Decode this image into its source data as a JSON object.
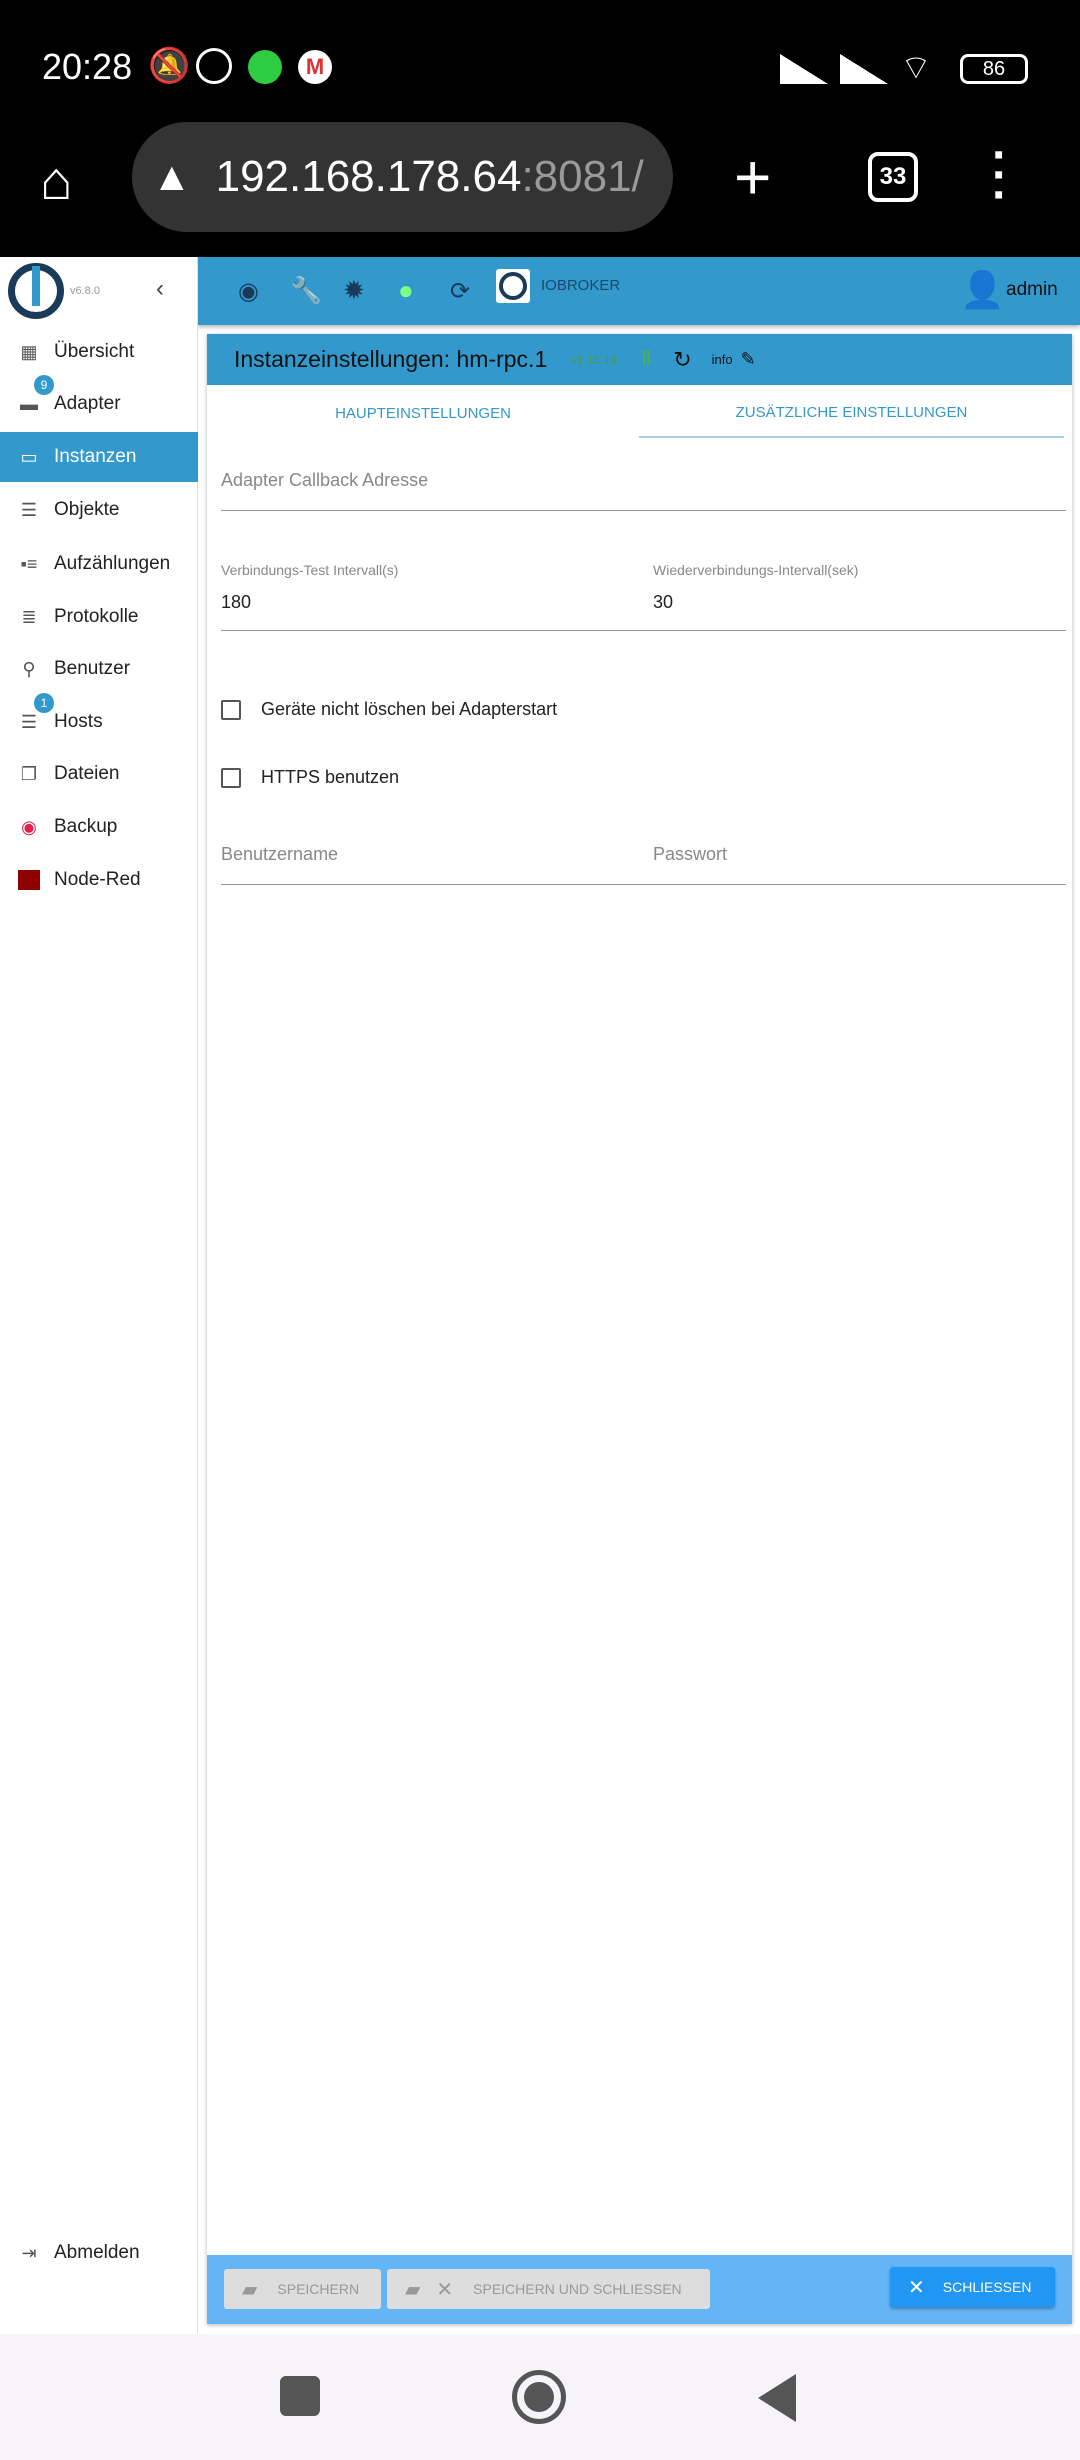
{
  "status_bar": {
    "time": "20:28",
    "battery": "86",
    "icons": [
      "bell-off-icon",
      "alarm-icon",
      "whatsapp-icon",
      "gmail-icon",
      "signal-icon",
      "signal-icon",
      "wifi-icon",
      "battery-icon"
    ]
  },
  "browser": {
    "url_host": "192.168.178.64",
    "url_port": ":8081/",
    "tab_count": "33"
  },
  "sidebar": {
    "version": "v6.8.0",
    "items": [
      {
        "label": "Übersicht",
        "icon": "grid-icon"
      },
      {
        "label": "Adapter",
        "icon": "store-icon",
        "badge": "9"
      },
      {
        "label": "Instanzen",
        "icon": "instances-icon",
        "selected": true
      },
      {
        "label": "Objekte",
        "icon": "list-icon"
      },
      {
        "label": "Aufzählungen",
        "icon": "enum-icon"
      },
      {
        "label": "Protokolle",
        "icon": "log-icon"
      },
      {
        "label": "Benutzer",
        "icon": "user-icon"
      },
      {
        "label": "Hosts",
        "icon": "hosts-icon",
        "badge": "1"
      },
      {
        "label": "Dateien",
        "icon": "files-icon"
      },
      {
        "label": "Backup",
        "icon": "backup-icon"
      },
      {
        "label": "Node-Red",
        "icon": "node-red-icon"
      }
    ],
    "logout": "Abmelden"
  },
  "topbar": {
    "brand": "IOBROKER",
    "user": "admin"
  },
  "instance": {
    "title": "Instanzeinstellungen: hm-rpc.1",
    "version": "v1.15.19",
    "info": "info"
  },
  "tabs": [
    {
      "label": "HAUPTEINSTELLUNGEN"
    },
    {
      "label": "ZUSÄTZLICHE EINSTELLUNGEN",
      "active": true
    }
  ],
  "form": {
    "callback_placeholder": "Adapter Callback Adresse",
    "test_interval_label": "Verbindungs-Test Intervall(s)",
    "test_interval_value": "180",
    "reconnect_label": "Wiederverbindungs-Intervall(sek)",
    "reconnect_value": "30",
    "keep_devices_label": "Geräte nicht löschen bei Adapterstart",
    "keep_devices_checked": false,
    "https_label": "HTTPS benutzen",
    "https_checked": false,
    "username_placeholder": "Benutzername",
    "password_placeholder": "Passwort"
  },
  "buttons": {
    "save": "SPEICHERN",
    "save_close": "SPEICHERN UND SCHLIESSEN",
    "close": "SCHLIESSEN"
  },
  "colors": {
    "primary": "#3399cc",
    "bottom_bar": "#64b5f6",
    "close_button": "#2196f3"
  }
}
